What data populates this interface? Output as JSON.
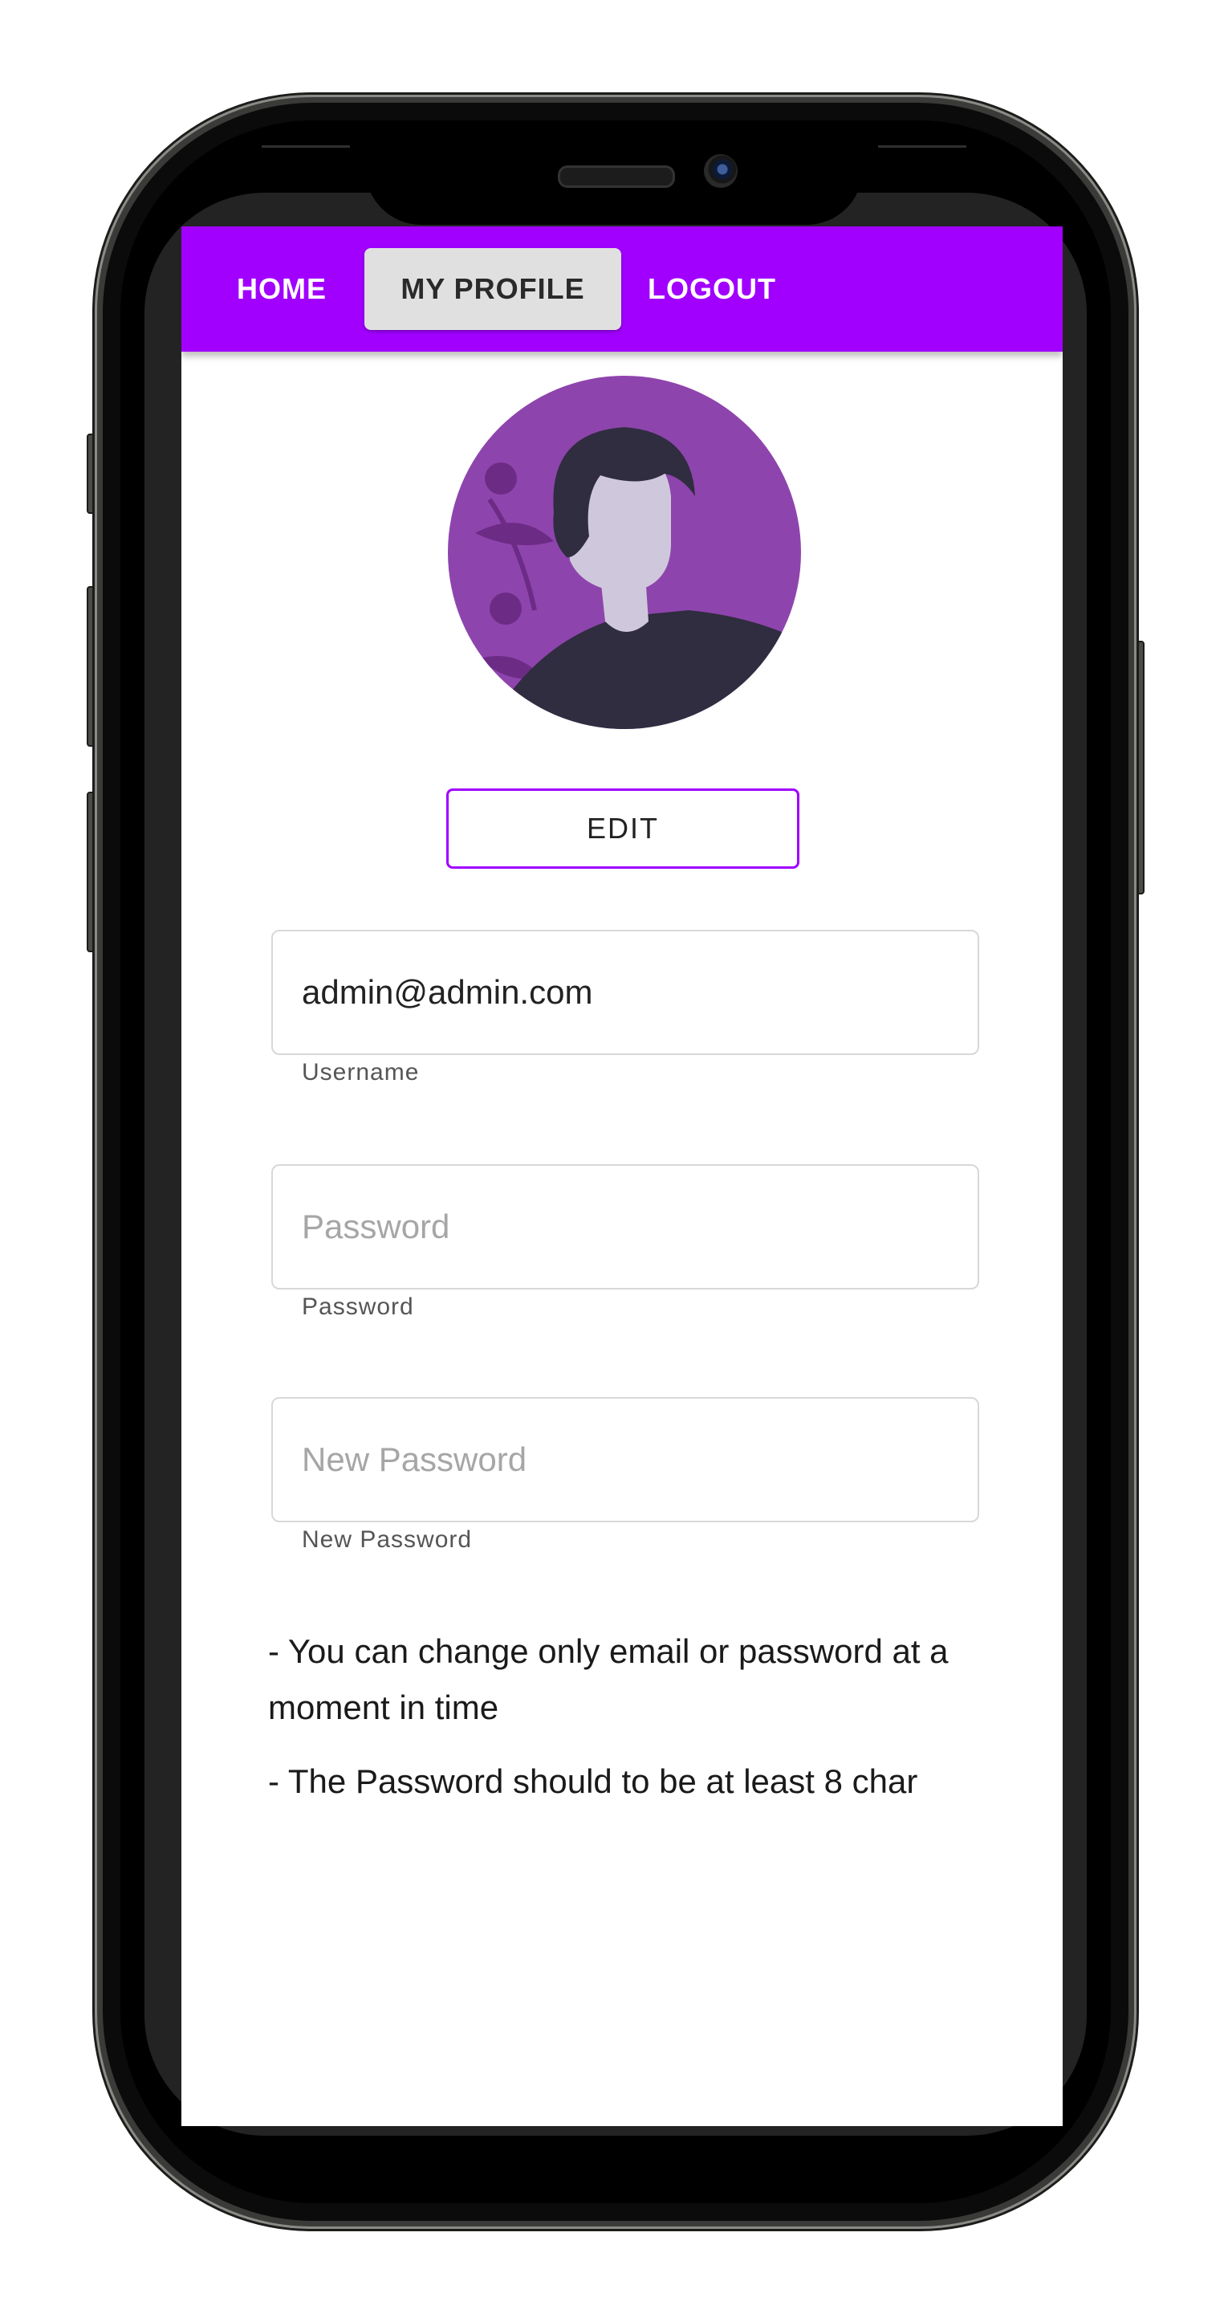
{
  "nav": {
    "home": "HOME",
    "my_profile": "MY PROFILE",
    "logout": "LOGOUT",
    "active": "MY PROFILE"
  },
  "profile": {
    "avatar_icon": "user-avatar-illustration",
    "edit_label": "EDIT"
  },
  "form": {
    "username": {
      "value": "admin@admin.com",
      "helper": "Username"
    },
    "password": {
      "value": "",
      "placeholder": "Password",
      "helper": "Password"
    },
    "new_password": {
      "value": "",
      "placeholder": "New Password",
      "helper": "New Password"
    }
  },
  "notes": [
    "- You can change only email or password at a moment in time",
    "- The Password should to be at least 8 char"
  ],
  "colors": {
    "accent": "#a100ff",
    "avatar_bg": "#8e44ad",
    "active_tab_bg": "#e0e0e0"
  }
}
